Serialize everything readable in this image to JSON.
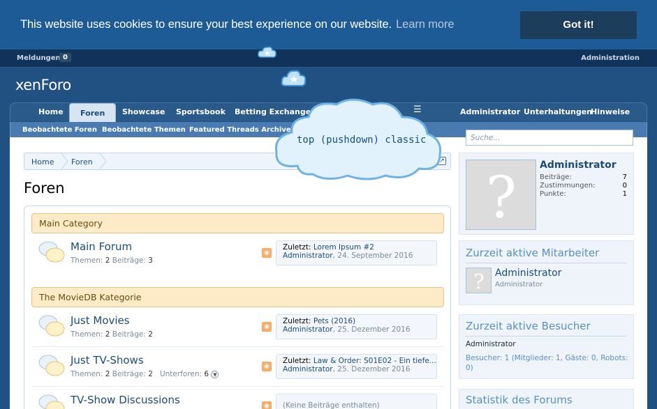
{
  "cookie": {
    "message": "This website uses cookies to ensure your best experience on our website.",
    "learn_more": "Learn more",
    "button": "Got it!"
  },
  "topbar": {
    "notifications_label": "Meldungen:",
    "notifications_count": "0",
    "admin_link": "Administration"
  },
  "logo": {
    "text": "xenForo"
  },
  "nav": {
    "tabs": [
      "Home",
      "Foren",
      "Showcase",
      "Sportsbook",
      "Betting Exchange"
    ],
    "active_tab": "Foren",
    "right": [
      "Administrator",
      "Unterhaltungen",
      "Hinweise"
    ]
  },
  "subnav": [
    "Beobachtete Foren",
    "Beobachtete Themen",
    "Featured Threads Archive"
  ],
  "tooltip": {
    "text": "top (pushdown) classic"
  },
  "breadcrumb": [
    "Home",
    "Foren"
  ],
  "page_title": "Foren",
  "categories": [
    {
      "title": "Main Category",
      "forums": [
        {
          "title": "Main Forum",
          "threads_label": "Themen:",
          "threads": "2",
          "posts_label": "Beiträge:",
          "posts": "3",
          "last_label": "Zuletzt:",
          "last_title": "Lorem Ipsum #2",
          "last_user": "Administrator",
          "last_date": "24. September 2016"
        }
      ]
    },
    {
      "title": "The MovieDB Kategorie",
      "forums": [
        {
          "title": "Just Movies",
          "threads_label": "Themen:",
          "threads": "2",
          "posts_label": "Beiträge:",
          "posts": "2",
          "last_label": "Zuletzt:",
          "last_title": "Pets (2016)",
          "last_user": "Administrator",
          "last_date": "25. Dezember 2016"
        },
        {
          "title": "Just TV-Shows",
          "threads_label": "Themen:",
          "threads": "2",
          "posts_label": "Beiträge:",
          "posts": "2",
          "subforums_label": "Unterforen:",
          "subforums": "6",
          "last_label": "Zuletzt:",
          "last_title": "Law & Order: S01E02 - Ein tiefe...",
          "last_user": "Administrator",
          "last_date": "25. Dezember 2016"
        },
        {
          "title": "TV-Show Discussions",
          "empty_label": "(Keine Beiträge enthalten)"
        }
      ]
    }
  ],
  "sidebar": {
    "search_placeholder": "Suche...",
    "user": {
      "name": "Administrator",
      "posts_label": "Beiträge:",
      "posts": "7",
      "likes_label": "Zustimmungen:",
      "likes": "0",
      "points_label": "Punkte:",
      "points": "1"
    },
    "staff": {
      "title": "Zurzeit aktive Mitarbeiter",
      "name": "Administrator",
      "role": "Administrator"
    },
    "visitors": {
      "title": "Zurzeit aktive Besucher",
      "name": "Administrator",
      "summary": "Besucher: 1 (Mitglieder: 1, Gäste: 0, Robots: 0)"
    },
    "stats": {
      "title": "Statistik des Forums"
    }
  }
}
